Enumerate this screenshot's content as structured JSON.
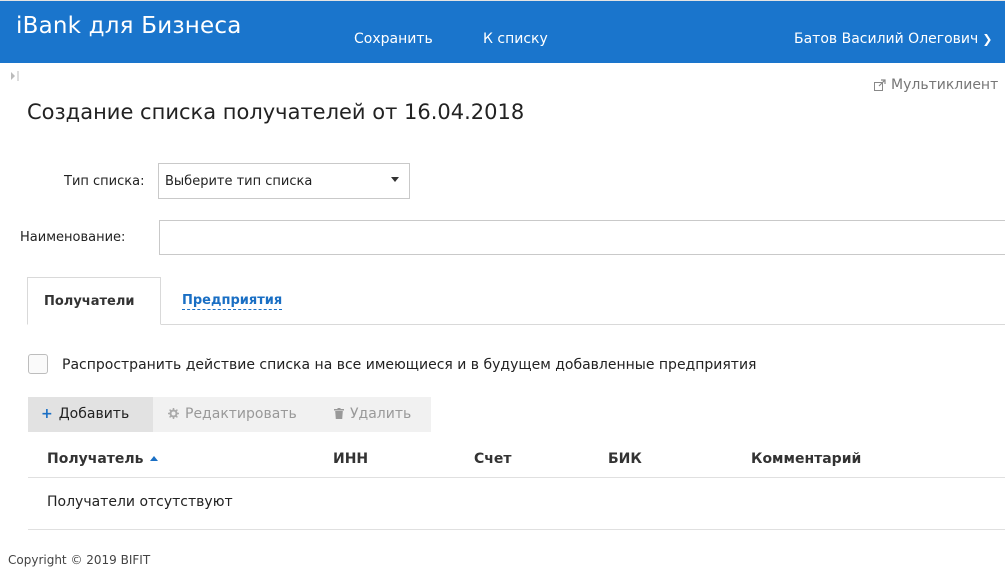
{
  "header": {
    "brand": "iBank для Бизнеса",
    "nav": [
      "Сохранить",
      "К списку"
    ],
    "user_name": "Батов Василий Олегович",
    "user_chevron_icon": "chevron-down-icon",
    "bg_color": "#1a75cc"
  },
  "toolbar_top": {
    "multiclient": "Мультиклиент",
    "multiclient_icon": "external-link-icon",
    "collapse_icon": "sidebar-expand-icon"
  },
  "page": {
    "title": "Создание списка получателей от 16.04.2018"
  },
  "form": {
    "list_type_label": "Тип списка:",
    "list_type_value": "Выберите тип списка",
    "name_label": "Наименование:",
    "name_value": ""
  },
  "tabs": [
    {
      "label": "Получатели",
      "active": true
    },
    {
      "label": "Предприятия",
      "active": false
    }
  ],
  "checkbox": {
    "label": "Распространить действие списка на все имеющиеся и в будущем добавленные предприятия",
    "checked": false
  },
  "actions": {
    "add": "Добавить",
    "edit": "Редактировать",
    "delete": "Удалить"
  },
  "table": {
    "columns": [
      "Получатель",
      "ИНН",
      "Счет",
      "БИК",
      "Комментарий"
    ],
    "sorted_column": "Получатель",
    "empty_text": "Получатели отсутствуют"
  },
  "footer": {
    "copyright": "Copyright © 2019 BIFIT"
  },
  "colors": {
    "accent": "#1a75cc",
    "link": "#1a6fc4"
  }
}
